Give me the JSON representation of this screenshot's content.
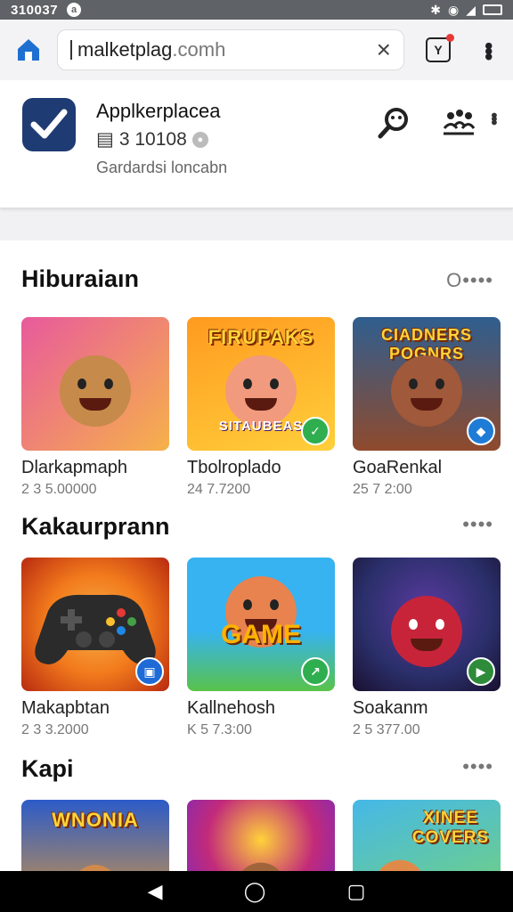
{
  "status": {
    "time": "310037",
    "notif_glyph": "a"
  },
  "browser": {
    "url_host": "malketplag",
    "url_tld": ".comh",
    "tabs_glyph": "Y"
  },
  "store": {
    "name": "Applkerplacea",
    "rating": "3 10108",
    "subtitle": "Gardardsi loncabn"
  },
  "sections": [
    {
      "title": "Hiburaiaın",
      "more": "O••••",
      "items": [
        {
          "name": "Dlarkapmaph",
          "meta": "2 3 5.00000",
          "banner": "",
          "colors": [
            "#e85a9c",
            "#f6b14a"
          ],
          "char_color": "#c68a4a",
          "badge_color": ""
        },
        {
          "name": "Tbolroplado",
          "meta": "24 7.7200",
          "banner": "FIRUPAKS",
          "sub_banner": "SITAUBEAS",
          "colors": [
            "#ff9a1f",
            "#ffcf3b"
          ],
          "char_color": "#f19a7d",
          "badge_color": "#2fae4f"
        },
        {
          "name": "GoaRenkal",
          "meta": "25 7 2:00",
          "banner": "CIADNERS POGNRS",
          "colors": [
            "#2f5e8f",
            "#8f4a2c"
          ],
          "char_color": "#a0593a",
          "badge_color": "#1e7bd6"
        }
      ]
    },
    {
      "title": "Kakaurprann",
      "more": "••••",
      "items": [
        {
          "name": "Makapbtan",
          "meta": "2 3 3.2000",
          "banner": "",
          "colors": [
            "#f27a1c",
            "#b82a10"
          ],
          "char_color": "#2b2b2b",
          "badge_color": "#1e6ad6"
        },
        {
          "name": "Kallnehosh",
          "meta": "K 5 7.3:00",
          "banner": "",
          "mid_banner": "GAME",
          "colors": [
            "#36b3f0",
            "#59c24a"
          ],
          "char_color": "#e8834f",
          "badge_color": "#2fae4f"
        },
        {
          "name": "Soakanm",
          "meta": "2 5 377.00",
          "banner": "",
          "colors": [
            "#2a2f6a",
            "#8a1a2a"
          ],
          "char_color": "#c7243a",
          "badge_color": "#2e8b3a"
        }
      ]
    },
    {
      "title": "Kapi",
      "more": "••••",
      "items": [
        {
          "name": "",
          "meta": "",
          "banner": "WNONIA",
          "colors": [
            "#2c5bc8",
            "#f0a12a"
          ],
          "char_color": "#d28a4a",
          "badge_color": ""
        },
        {
          "name": "",
          "meta": "",
          "banner": "",
          "colors": [
            "#c22a7a",
            "#5a2ad8"
          ],
          "char_color": "#a0643a",
          "badge_color": ""
        },
        {
          "name": "",
          "meta": "",
          "banner": "XINEE COVERS",
          "colors": [
            "#45b8e8",
            "#ffd23a"
          ],
          "char_color": "#e08a4a",
          "badge_color": ""
        }
      ]
    }
  ],
  "nav": {
    "back": "◀",
    "home": "◯",
    "recents": "▢"
  },
  "colors": {
    "accent": "#1f6fd1",
    "logo_bg": "#1f3b73"
  }
}
